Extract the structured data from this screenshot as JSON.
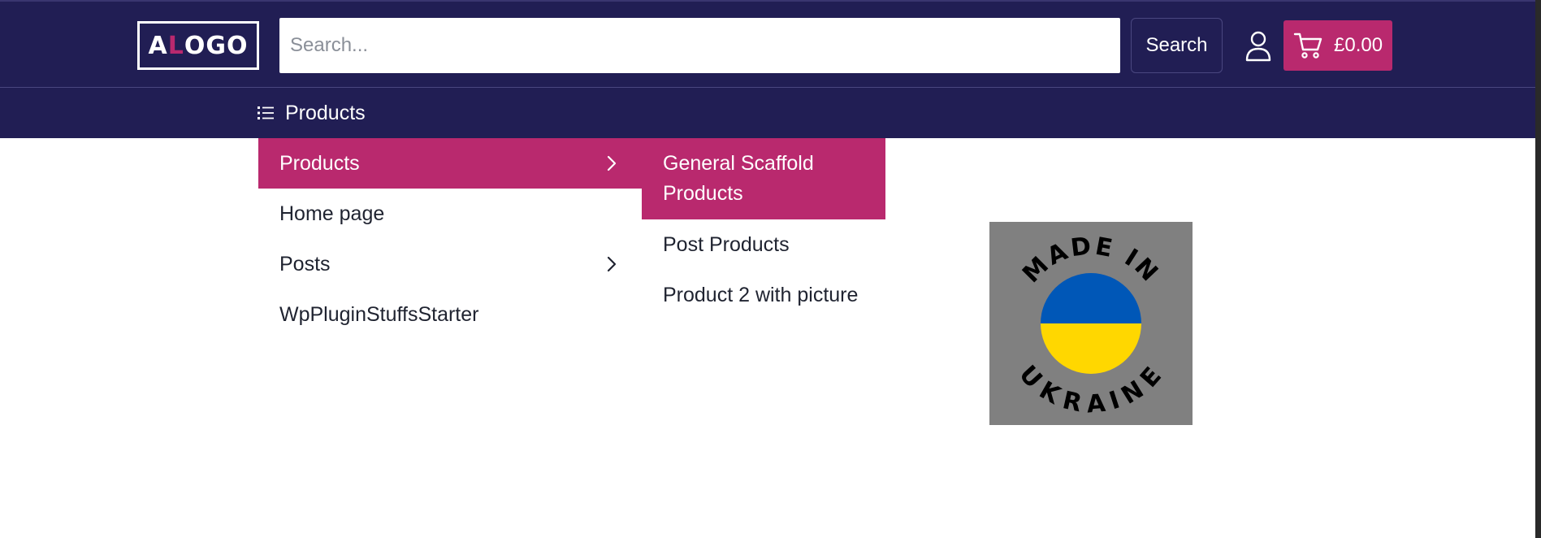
{
  "header": {
    "logo_prefix": "A",
    "logo_accent": "L",
    "logo_rest": "OGO",
    "search": {
      "placeholder": "Search...",
      "value": ""
    },
    "search_button_label": "Search",
    "cart_total": "£0.00"
  },
  "nav": {
    "products_label": "Products"
  },
  "menu": {
    "level1": [
      {
        "label": "Products",
        "has_submenu": true,
        "active": true
      },
      {
        "label": "Home page",
        "has_submenu": false,
        "active": false
      },
      {
        "label": "Posts",
        "has_submenu": true,
        "active": false
      },
      {
        "label": "WpPluginStuffsStarter",
        "has_submenu": false,
        "active": false
      }
    ],
    "level2": [
      {
        "label": "General Scaffold Products",
        "active": true
      },
      {
        "label": "Post Products",
        "active": false
      },
      {
        "label": "Product 2 with picture",
        "active": false
      }
    ]
  },
  "badge": {
    "top_text": "MADE IN",
    "bottom_text": "UKRAINE",
    "flag_colors": [
      "#0057b7",
      "#ffd700"
    ]
  },
  "colors": {
    "navy": "#211e54",
    "accent": "#b9296e"
  },
  "icons": [
    "list-icon",
    "user-icon",
    "cart-icon",
    "chevron-right-icon"
  ]
}
